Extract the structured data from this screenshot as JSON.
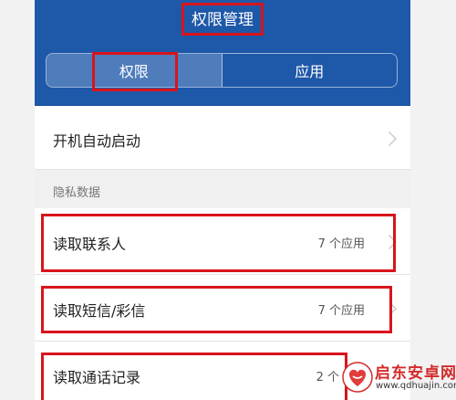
{
  "header": {
    "title": "权限管理",
    "background_color": "#1e58a8"
  },
  "tabs": [
    {
      "label": "权限",
      "active": true
    },
    {
      "label": "应用",
      "active": false
    }
  ],
  "rows": {
    "autostart": {
      "label": "开机自动启动"
    },
    "contacts": {
      "label": "读取联系人",
      "count": "7 个应用"
    },
    "sms": {
      "label": "读取短信/彩信",
      "count": "7 个应用"
    },
    "calllog": {
      "label": "读取通话记录",
      "count": "2 个"
    }
  },
  "section": {
    "privacy_label": "隐私数据"
  },
  "icons": {
    "chevron": "chevron-right-icon",
    "watermark_logo": "heart-logo-icon"
  },
  "watermark": {
    "name": "启东安卓网",
    "url": "www.qdhuajin.com"
  },
  "colors": {
    "highlight": "#d8141c",
    "watermark": "#d42a2a"
  }
}
